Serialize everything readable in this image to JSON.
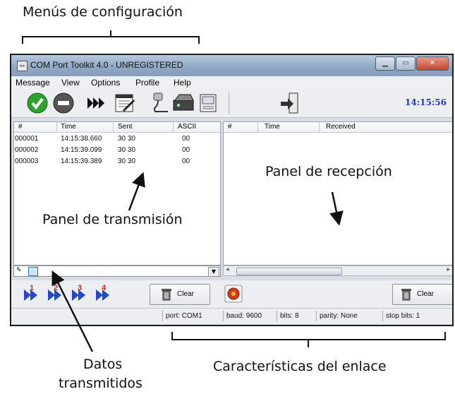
{
  "annotations": {
    "menus": "Menús de configuración",
    "tx_panel": "Panel de transmisión",
    "rx_panel": "Panel de recepción",
    "sent_data_line1": "Datos",
    "sent_data_line2": "transmitidos",
    "link": "Características del enlace"
  },
  "window": {
    "title": "COM Port Toolkit 4.0 - UNREGISTERED"
  },
  "menu": [
    "Message",
    "View",
    "Options",
    "Profile",
    "Help"
  ],
  "toolbar": {
    "clock": "14:15:56"
  },
  "sent_table": {
    "headers": [
      "#",
      "Time",
      "Sent",
      "ASCII"
    ],
    "rows": [
      [
        "000001",
        "14:15:38.660",
        "30 30",
        "00"
      ],
      [
        "000002",
        "14:15:39.099",
        "30 30",
        "00"
      ],
      [
        "000003",
        "14:15:39.389",
        "30 30",
        "00"
      ]
    ]
  },
  "recv_table": {
    "headers": [
      "#",
      "Time",
      "Received"
    ]
  },
  "bottom": {
    "clear_left": "Clear",
    "clear_right": "Clear",
    "macro_numbers": [
      "1",
      "2",
      "3",
      "4"
    ]
  },
  "status": {
    "port": "port: COM1",
    "baud": "baud: 9600",
    "bits": "bits: 8",
    "parity": "parity: None",
    "stop": "stop bits: 1"
  },
  "colors": {
    "clock": "#2233cc",
    "titlebar": "#8fa7c2",
    "annotation": "#111111"
  }
}
